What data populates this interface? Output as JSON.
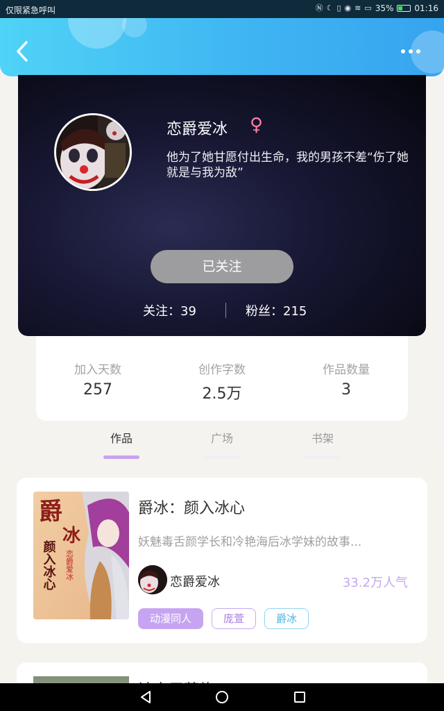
{
  "status_bar": {
    "left_text": "仅限紧急呼叫",
    "battery": "35%",
    "battery_level": 0.35,
    "time": "01:16"
  },
  "header": {
    "back_icon": "chevron-left-icon",
    "more_icon": "more-horizontal-icon"
  },
  "profile": {
    "nickname": "恋爵爱冰",
    "gender_symbol": "♀",
    "bio": "他为了她甘愿付出生命，我的男孩不差“伤了她就是与我为敌”",
    "follow_button": "已关注",
    "following": "关注：39",
    "fans": "粉丝：215"
  },
  "stats": [
    {
      "label": "加入天数",
      "value": "257"
    },
    {
      "label": "创作字数",
      "value": "2.5万"
    },
    {
      "label": "作品数量",
      "value": "3"
    }
  ],
  "tabs": [
    {
      "label": "作品",
      "active": true
    },
    {
      "label": "广场",
      "active": false
    },
    {
      "label": "书架",
      "active": false
    }
  ],
  "books": [
    {
      "title": "爵冰：颜入冰心",
      "description": "妖魅毒舌颜学长和冷艳海后冰学妹的故事...",
      "author": "恋爵爱冰",
      "popularity": "33.2万人气",
      "tags": [
        "动漫同人",
        "庞萱",
        "爵冰"
      ],
      "cover_text": {
        "title_line1": "爵",
        "title_line2": "冰",
        "subtitle": "颜入冰心",
        "author": "恋爵爱冰"
      }
    },
    {
      "title": "该家屋萧绝"
    }
  ],
  "colors": {
    "header_start": "#4fd3f6",
    "header_end": "#36a4ef",
    "accent_purple": "#c7a4f2",
    "accent_blue": "#4cb3e6",
    "female": "#ff7ea3"
  }
}
